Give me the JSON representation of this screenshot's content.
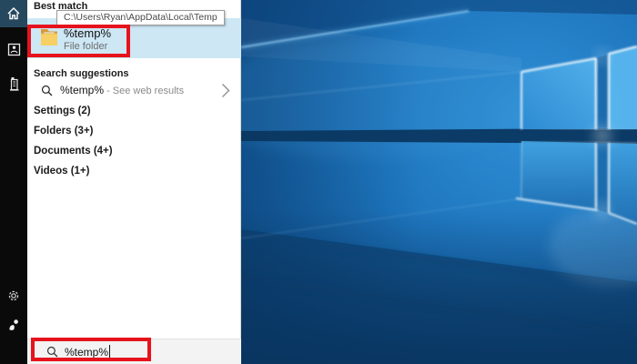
{
  "sidebar": {
    "icons": [
      {
        "name": "home-icon"
      },
      {
        "name": "notebook-icon"
      },
      {
        "name": "places-icon"
      },
      {
        "name": "settings-gear-icon"
      },
      {
        "name": "feedback-icon"
      }
    ]
  },
  "panel": {
    "best_match": {
      "header": "Best match",
      "title": "%temp%",
      "subtitle": "File folder",
      "icon": "folder-icon"
    },
    "tooltip": {
      "text": "C:\\Users\\Ryan\\AppData\\Local\\Temp"
    },
    "suggestions": {
      "header": "Search suggestions",
      "query": "%temp%",
      "hint": " - See web results",
      "icon": "search-icon",
      "chevron": "chevron-right-icon"
    },
    "categories": [
      {
        "label": "Settings (2)"
      },
      {
        "label": "Folders (3+)"
      },
      {
        "label": "Documents (4+)"
      },
      {
        "label": "Videos (1+)"
      }
    ],
    "search_box": {
      "value": "%temp%",
      "icon": "search-icon"
    }
  },
  "annotations": {
    "color": "#e6131c",
    "count": 2
  },
  "colors": {
    "best_match_highlight": "#cde7f5",
    "rail_home_tile": "#26485e",
    "panel_bg": "#ffffff",
    "searchbar_bg": "#f3f3f3",
    "wallpaper_mid_blue": "#1d74bc",
    "wallpaper_dark_band": "#0a3660"
  }
}
